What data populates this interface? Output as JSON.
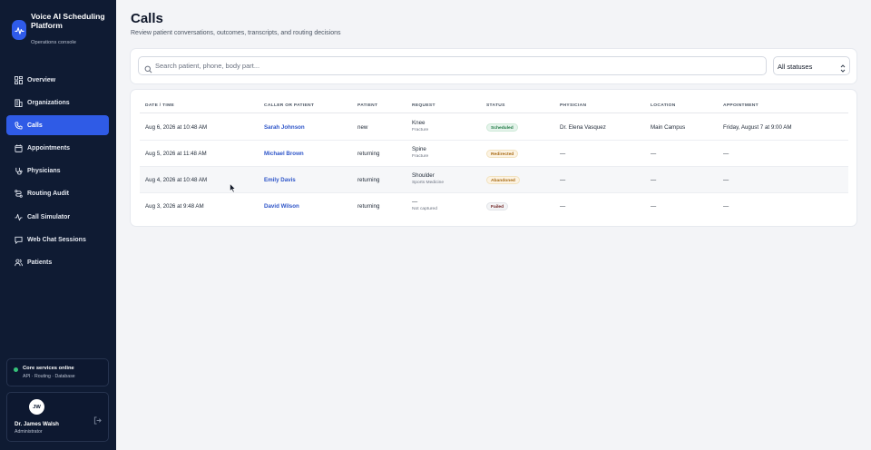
{
  "app": {
    "title": "Voice AI Scheduling Platform",
    "subtitle": "Operations console"
  },
  "nav": [
    {
      "label": "Overview",
      "icon": "grid-icon",
      "active": false
    },
    {
      "label": "Organizations",
      "icon": "building-icon",
      "active": false
    },
    {
      "label": "Calls",
      "icon": "phone-icon",
      "active": true
    },
    {
      "label": "Appointments",
      "icon": "calendar-icon",
      "active": false
    },
    {
      "label": "Physicians",
      "icon": "stethoscope-icon",
      "active": false
    },
    {
      "label": "Routing Audit",
      "icon": "routing-icon",
      "active": false
    },
    {
      "label": "Call Simulator",
      "icon": "pulse-icon",
      "active": false
    },
    {
      "label": "Web Chat Sessions",
      "icon": "chat-icon",
      "active": false
    },
    {
      "label": "Patients",
      "icon": "users-icon",
      "active": false
    }
  ],
  "system_status": {
    "title": "Core services online",
    "detail": "API · Routing · Database",
    "color": "#36c27a"
  },
  "user": {
    "initials": "JW",
    "name": "Dr. James Walsh",
    "role": "Administrator"
  },
  "page": {
    "title": "Calls",
    "subtitle": "Review patient conversations, outcomes, transcripts, and routing decisions"
  },
  "search": {
    "placeholder": "Search patient, phone, body part...",
    "value": ""
  },
  "status_filter": {
    "selected": "All statuses"
  },
  "table": {
    "columns": [
      "DATE / TIME",
      "CALLER OR PATIENT",
      "PATIENT",
      "REQUEST",
      "STATUS",
      "PHYSICIAN",
      "LOCATION",
      "APPOINTMENT"
    ],
    "rows": [
      {
        "datetime": "Aug 6, 2026 at 10:48 AM",
        "caller": "Sarah Johnson",
        "patient": "new",
        "request": "Knee",
        "request_detail": "Fracture",
        "status": "Scheduled",
        "status_style": "scheduled",
        "physician": "Dr. Elena Vasquez",
        "location": "Main Campus",
        "appointment": "Friday, August 7 at 9:00 AM"
      },
      {
        "datetime": "Aug 5, 2026 at 11:48 AM",
        "caller": "Michael Brown",
        "patient": "returning",
        "request": "Spine",
        "request_detail": "Fracture",
        "status": "Redirected",
        "status_style": "redirected",
        "physician": "—",
        "location": "—",
        "appointment": "—"
      },
      {
        "datetime": "Aug 4, 2026 at 10:48 AM",
        "caller": "Emily Davis",
        "patient": "returning",
        "request": "Shoulder",
        "request_detail": "Sports Medicine",
        "status": "Abandoned",
        "status_style": "abandoned",
        "physician": "—",
        "location": "—",
        "appointment": "—"
      },
      {
        "datetime": "Aug 3, 2026 at 9:48 AM",
        "caller": "David Wilson",
        "patient": "returning",
        "request": "—",
        "request_detail": "Not captured",
        "status": "Failed",
        "status_style": "failed",
        "physician": "—",
        "location": "—",
        "appointment": "—"
      }
    ]
  },
  "colors": {
    "sidebar": "#0f1b33",
    "accent": "#2f5be6",
    "link": "#2f56c9",
    "scheduled": "#1f7a44",
    "redirected": "#a86a12",
    "abandoned": "#a86a12",
    "failed": "#6b1d1d"
  }
}
